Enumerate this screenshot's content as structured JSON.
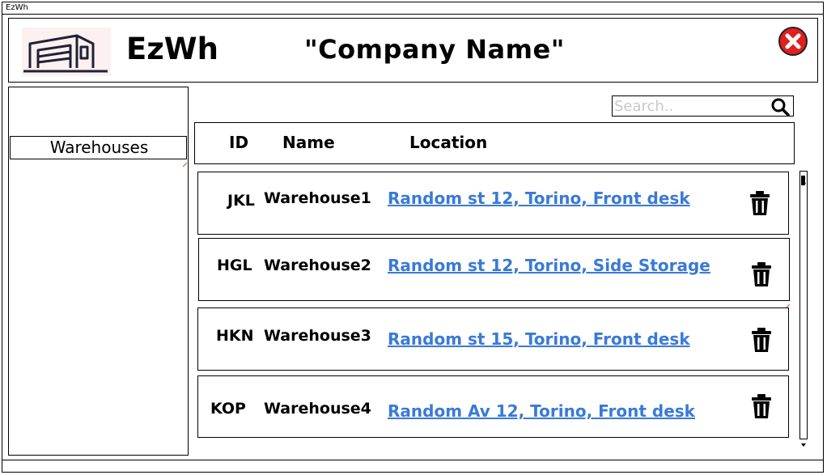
{
  "window": {
    "title": "EzWh"
  },
  "header": {
    "app_name": "EzWh",
    "company_name": "\"Company Name\"",
    "logo_icon": "warehouse-icon",
    "close_icon": "close-icon",
    "close_color": "#e0201f"
  },
  "sidebar": {
    "items": [
      {
        "label": "Warehouses"
      }
    ]
  },
  "search": {
    "placeholder": "Search..",
    "value": "",
    "icon": "search-icon"
  },
  "table": {
    "columns": [
      "ID",
      "Name",
      "Location"
    ],
    "rows": [
      {
        "id": "JKL",
        "name": "Warehouse1",
        "location": "Random st 12, Torino, Front desk",
        "action_icon": "trash-icon"
      },
      {
        "id": "HGL",
        "name": "Warehouse2",
        "location": "Random st 12, Torino, Side Storage",
        "action_icon": "trash-icon"
      },
      {
        "id": "HKN",
        "name": "Warehouse3",
        "location": "Random st 15, Torino, Front desk",
        "action_icon": "trash-icon"
      },
      {
        "id": "KOP",
        "name": "Warehouse4",
        "location": "Random Av 12, Torino, Front desk",
        "action_icon": "trash-icon"
      }
    ]
  },
  "colors": {
    "link": "#3a7ad6",
    "close": "#e0201f",
    "logo_bg": "#fdf0f0"
  }
}
